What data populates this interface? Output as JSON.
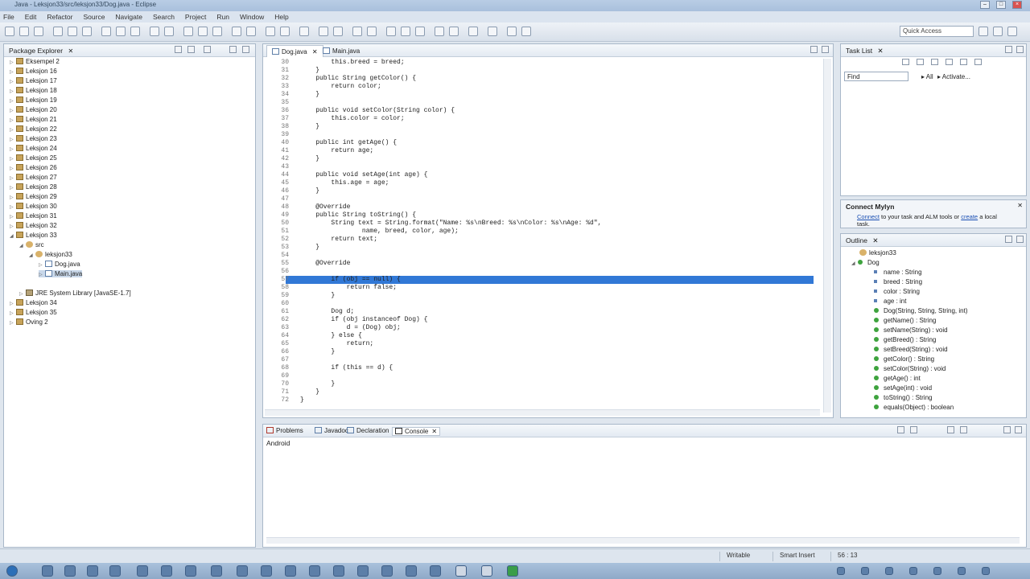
{
  "title": "Java - Leksjon33/src/leksjon33/Dog.java - Eclipse",
  "menu": [
    "File",
    "Edit",
    "Refactor",
    "Source",
    "Navigate",
    "Search",
    "Project",
    "Run",
    "Window",
    "Help"
  ],
  "quick_access": "Quick Access",
  "package_explorer": {
    "title": "Package Explorer",
    "items": [
      {
        "label": "Eksempel 2"
      },
      {
        "label": "Leksjon 16"
      },
      {
        "label": "Leksjon 17"
      },
      {
        "label": "Leksjon 18"
      },
      {
        "label": "Leksjon 19"
      },
      {
        "label": "Leksjon 20"
      },
      {
        "label": "Leksjon 21"
      },
      {
        "label": "Leksjon 22"
      },
      {
        "label": "Leksjon 23"
      },
      {
        "label": "Leksjon 24"
      },
      {
        "label": "Leksjon 25"
      },
      {
        "label": "Leksjon 26"
      },
      {
        "label": "Leksjon 27"
      },
      {
        "label": "Leksjon 28"
      },
      {
        "label": "Leksjon 29"
      },
      {
        "label": "Leksjon 30"
      },
      {
        "label": "Leksjon 31"
      },
      {
        "label": "Leksjon 32"
      },
      {
        "label": "Leksjon 33"
      },
      {
        "label": "src"
      },
      {
        "label": "leksjon33"
      },
      {
        "label": "Dog.java"
      },
      {
        "label": "Main.java"
      },
      {
        "label": "JRE System Library [JavaSE-1.7]"
      },
      {
        "label": "Leksjon 34"
      },
      {
        "label": "Leksjon 35"
      },
      {
        "label": "Oving 2"
      }
    ]
  },
  "editor": {
    "tabs": [
      "Dog.java",
      "Main.java"
    ],
    "lines": [
      {
        "n": "30",
        "t": "        this.breed = breed;"
      },
      {
        "n": "31",
        "t": "    }"
      },
      {
        "n": "32",
        "t": "    public String getColor() {"
      },
      {
        "n": "33",
        "t": "        return color;"
      },
      {
        "n": "34",
        "t": "    }"
      },
      {
        "n": "35",
        "t": ""
      },
      {
        "n": "36",
        "t": "    public void setColor(String color) {"
      },
      {
        "n": "37",
        "t": "        this.color = color;"
      },
      {
        "n": "38",
        "t": "    }"
      },
      {
        "n": "39",
        "t": ""
      },
      {
        "n": "40",
        "t": "    public int getAge() {"
      },
      {
        "n": "41",
        "t": "        return age;"
      },
      {
        "n": "42",
        "t": "    }"
      },
      {
        "n": "43",
        "t": ""
      },
      {
        "n": "44",
        "t": "    public void setAge(int age) {"
      },
      {
        "n": "45",
        "t": "        this.age = age;"
      },
      {
        "n": "46",
        "t": "    }"
      },
      {
        "n": "47",
        "t": ""
      },
      {
        "n": "48",
        "t": "    @Override"
      },
      {
        "n": "49",
        "t": "    public String toString() {"
      },
      {
        "n": "50",
        "t": "        String text = String.format(\"Name: %s\\nBreed: %s\\nColor: %s\\nAge: %d\","
      },
      {
        "n": "51",
        "t": "                name, breed, color, age);"
      },
      {
        "n": "52",
        "t": "        return text;"
      },
      {
        "n": "53",
        "t": "    }"
      },
      {
        "n": "54",
        "t": ""
      },
      {
        "n": "55",
        "t": "    @Override"
      },
      {
        "n": "56",
        "t": "    public boolean equals(Object obj) {"
      },
      {
        "n": "57",
        "t": "        if (obj == null) {"
      },
      {
        "n": "58",
        "t": "            return false;"
      },
      {
        "n": "59",
        "t": "        }"
      },
      {
        "n": "60",
        "t": ""
      },
      {
        "n": "61",
        "t": "        Dog d;"
      },
      {
        "n": "62",
        "t": "        if (obj instanceof Dog) {"
      },
      {
        "n": "63",
        "t": "            d = (Dog) obj;"
      },
      {
        "n": "64",
        "t": "        } else {"
      },
      {
        "n": "65",
        "t": "            return;"
      },
      {
        "n": "66",
        "t": "        }"
      },
      {
        "n": "67",
        "t": ""
      },
      {
        "n": "68",
        "t": "        if (this == d) {"
      },
      {
        "n": "69",
        "t": ""
      },
      {
        "n": "70",
        "t": "        }"
      },
      {
        "n": "71",
        "t": "    }"
      },
      {
        "n": "72",
        "t": "}"
      }
    ]
  },
  "task_list": {
    "title": "Task List",
    "find": "Find",
    "all": "All",
    "activate": "Activate..."
  },
  "mylyn": {
    "title": "Connect Mylyn",
    "connect": "Connect",
    "text": " to your task and ALM tools or ",
    "create": "create",
    "text2": " a local task."
  },
  "outline": {
    "title": "Outline",
    "package": "leksjon33",
    "class": "Dog",
    "members": [
      {
        "label": "name : String",
        "kind": "field"
      },
      {
        "label": "breed : String",
        "kind": "field"
      },
      {
        "label": "color : String",
        "kind": "field"
      },
      {
        "label": "age : int",
        "kind": "field"
      },
      {
        "label": "Dog(String, String, String, int)",
        "kind": "method"
      },
      {
        "label": "getName() : String",
        "kind": "method"
      },
      {
        "label": "setName(String) : void",
        "kind": "method"
      },
      {
        "label": "getBreed() : String",
        "kind": "method"
      },
      {
        "label": "setBreed(String) : void",
        "kind": "method"
      },
      {
        "label": "getColor() : String",
        "kind": "method"
      },
      {
        "label": "setColor(String) : void",
        "kind": "method"
      },
      {
        "label": "getAge() : int",
        "kind": "method"
      },
      {
        "label": "setAge(int) : void",
        "kind": "method"
      },
      {
        "label": "toString() : String",
        "kind": "method"
      },
      {
        "label": "equals(Object) : boolean",
        "kind": "method"
      }
    ]
  },
  "bottom": {
    "tabs": [
      "Problems",
      "Javadoc",
      "Declaration",
      "Console"
    ],
    "console_label": "Android"
  },
  "status": {
    "writable": "Writable",
    "insert": "Smart Insert",
    "position": "56 : 13"
  },
  "colors": {
    "selection": "#3178d6",
    "panel_border": "#a9b8c9"
  }
}
